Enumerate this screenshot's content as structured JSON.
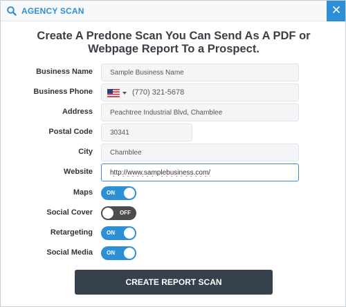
{
  "window": {
    "title": "AGENCY SCAN",
    "title_icon": "search-icon",
    "close_icon": "close-icon",
    "accent": "#2d8fd5"
  },
  "headline": "Create A Predone Scan You Can Send As A PDF or Webpage Report To a Prospect.",
  "form": {
    "business_name": {
      "label": "Business Name",
      "value": "Sample Business Name"
    },
    "business_phone": {
      "label": "Business Phone",
      "value": "(770) 321-5678",
      "country_flag": "us-flag-icon"
    },
    "address": {
      "label": "Address",
      "value": "Peachtree Industrial Blvd, Chamblee"
    },
    "postal_code": {
      "label": "Postal Code",
      "value": "30341"
    },
    "city": {
      "label": "City",
      "value": "Chamblee"
    },
    "website": {
      "label": "Website",
      "value": "http://www.samplebusiness.com/"
    }
  },
  "toggles": {
    "maps": {
      "label": "Maps",
      "state": "ON"
    },
    "social_cover": {
      "label": "Social Cover",
      "state": "OFF"
    },
    "retargeting": {
      "label": "Retargeting",
      "state": "ON"
    },
    "social_media": {
      "label": "Social Media",
      "state": "ON"
    }
  },
  "submit_label": "CREATE REPORT SCAN",
  "colors": {
    "toggle_on": "#2d8fd5",
    "toggle_off": "#4d4d4d",
    "button": "#36414d"
  }
}
